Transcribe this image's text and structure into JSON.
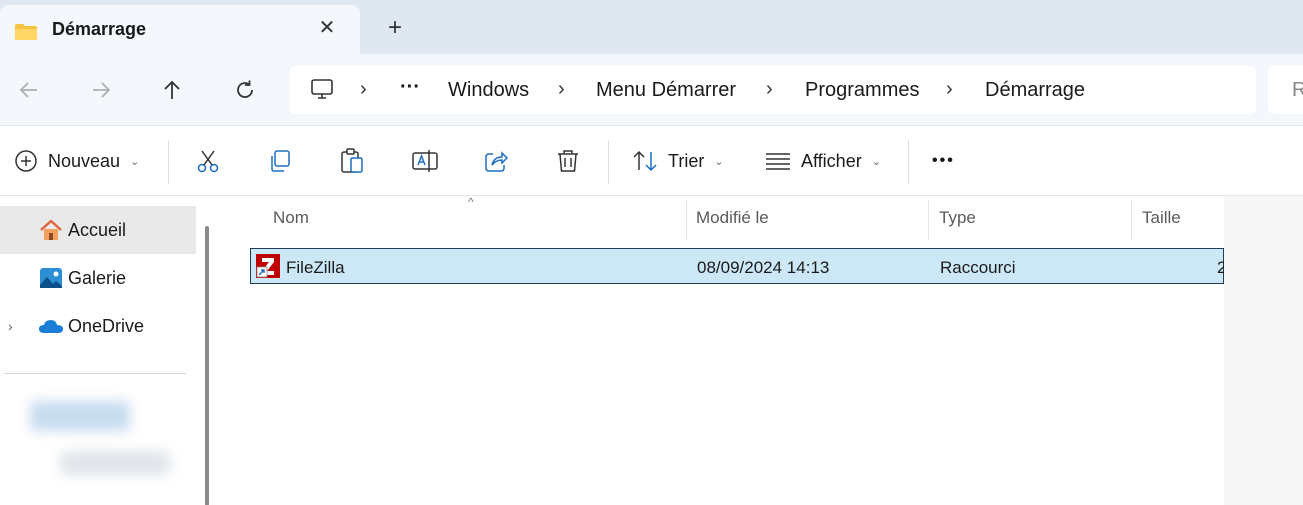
{
  "window": {
    "tab_title": "Démarrage",
    "close_glyph": "✕",
    "new_tab_glyph": "+"
  },
  "nav": {
    "back_icon": "arrow-left-icon",
    "forward_icon": "arrow-right-icon",
    "up_icon": "arrow-up-icon",
    "refresh_icon": "refresh-icon"
  },
  "breadcrumb": {
    "ellipsis": "···",
    "items": [
      "Windows",
      "Menu Démarrer",
      "Programmes",
      "Démarrage"
    ],
    "chevron": "›"
  },
  "search": {
    "placeholder_visible": "R"
  },
  "toolbar": {
    "new_label": "Nouveau",
    "sort_label": "Trier",
    "view_label": "Afficher",
    "more_label": "•••",
    "caret": "⌄"
  },
  "sidebar": {
    "items": [
      {
        "label": "Accueil",
        "icon": "home-icon",
        "active": true
      },
      {
        "label": "Galerie",
        "icon": "gallery-icon",
        "active": false
      },
      {
        "label": "OneDrive",
        "icon": "cloud-icon",
        "active": false,
        "expand": "›"
      }
    ]
  },
  "table": {
    "columns": [
      "Nom",
      "Modifié le",
      "Type",
      "Taille"
    ],
    "sort_caret": "^",
    "rows": [
      {
        "name": "FileZilla",
        "modified": "08/09/2024 14:13",
        "type": "Raccourci",
        "size": "2"
      }
    ]
  },
  "colors": {
    "selection": "#cce8f7",
    "selection_border": "#1f3e5a",
    "tabstrip": "#dfe8f0",
    "accent": "#0067c0"
  }
}
